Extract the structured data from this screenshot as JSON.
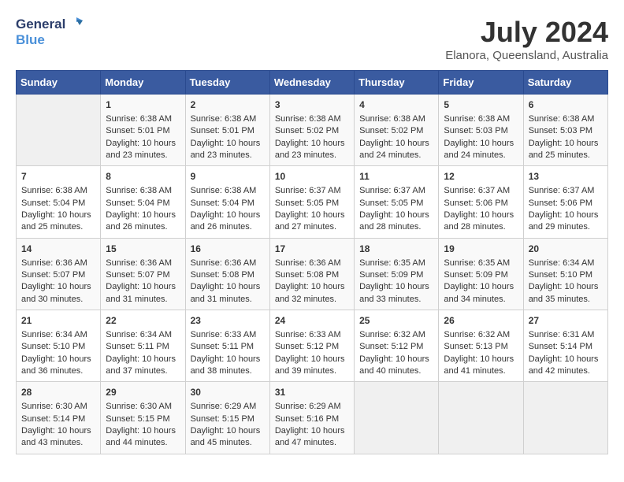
{
  "header": {
    "logo_line1": "General",
    "logo_line2": "Blue",
    "month_year": "July 2024",
    "location": "Elanora, Queensland, Australia"
  },
  "weekdays": [
    "Sunday",
    "Monday",
    "Tuesday",
    "Wednesday",
    "Thursday",
    "Friday",
    "Saturday"
  ],
  "weeks": [
    [
      {
        "day": "",
        "content": ""
      },
      {
        "day": "1",
        "content": "Sunrise: 6:38 AM\nSunset: 5:01 PM\nDaylight: 10 hours\nand 23 minutes."
      },
      {
        "day": "2",
        "content": "Sunrise: 6:38 AM\nSunset: 5:01 PM\nDaylight: 10 hours\nand 23 minutes."
      },
      {
        "day": "3",
        "content": "Sunrise: 6:38 AM\nSunset: 5:02 PM\nDaylight: 10 hours\nand 23 minutes."
      },
      {
        "day": "4",
        "content": "Sunrise: 6:38 AM\nSunset: 5:02 PM\nDaylight: 10 hours\nand 24 minutes."
      },
      {
        "day": "5",
        "content": "Sunrise: 6:38 AM\nSunset: 5:03 PM\nDaylight: 10 hours\nand 24 minutes."
      },
      {
        "day": "6",
        "content": "Sunrise: 6:38 AM\nSunset: 5:03 PM\nDaylight: 10 hours\nand 25 minutes."
      }
    ],
    [
      {
        "day": "7",
        "content": "Sunrise: 6:38 AM\nSunset: 5:04 PM\nDaylight: 10 hours\nand 25 minutes."
      },
      {
        "day": "8",
        "content": "Sunrise: 6:38 AM\nSunset: 5:04 PM\nDaylight: 10 hours\nand 26 minutes."
      },
      {
        "day": "9",
        "content": "Sunrise: 6:38 AM\nSunset: 5:04 PM\nDaylight: 10 hours\nand 26 minutes."
      },
      {
        "day": "10",
        "content": "Sunrise: 6:37 AM\nSunset: 5:05 PM\nDaylight: 10 hours\nand 27 minutes."
      },
      {
        "day": "11",
        "content": "Sunrise: 6:37 AM\nSunset: 5:05 PM\nDaylight: 10 hours\nand 28 minutes."
      },
      {
        "day": "12",
        "content": "Sunrise: 6:37 AM\nSunset: 5:06 PM\nDaylight: 10 hours\nand 28 minutes."
      },
      {
        "day": "13",
        "content": "Sunrise: 6:37 AM\nSunset: 5:06 PM\nDaylight: 10 hours\nand 29 minutes."
      }
    ],
    [
      {
        "day": "14",
        "content": "Sunrise: 6:36 AM\nSunset: 5:07 PM\nDaylight: 10 hours\nand 30 minutes."
      },
      {
        "day": "15",
        "content": "Sunrise: 6:36 AM\nSunset: 5:07 PM\nDaylight: 10 hours\nand 31 minutes."
      },
      {
        "day": "16",
        "content": "Sunrise: 6:36 AM\nSunset: 5:08 PM\nDaylight: 10 hours\nand 31 minutes."
      },
      {
        "day": "17",
        "content": "Sunrise: 6:36 AM\nSunset: 5:08 PM\nDaylight: 10 hours\nand 32 minutes."
      },
      {
        "day": "18",
        "content": "Sunrise: 6:35 AM\nSunset: 5:09 PM\nDaylight: 10 hours\nand 33 minutes."
      },
      {
        "day": "19",
        "content": "Sunrise: 6:35 AM\nSunset: 5:09 PM\nDaylight: 10 hours\nand 34 minutes."
      },
      {
        "day": "20",
        "content": "Sunrise: 6:34 AM\nSunset: 5:10 PM\nDaylight: 10 hours\nand 35 minutes."
      }
    ],
    [
      {
        "day": "21",
        "content": "Sunrise: 6:34 AM\nSunset: 5:10 PM\nDaylight: 10 hours\nand 36 minutes."
      },
      {
        "day": "22",
        "content": "Sunrise: 6:34 AM\nSunset: 5:11 PM\nDaylight: 10 hours\nand 37 minutes."
      },
      {
        "day": "23",
        "content": "Sunrise: 6:33 AM\nSunset: 5:11 PM\nDaylight: 10 hours\nand 38 minutes."
      },
      {
        "day": "24",
        "content": "Sunrise: 6:33 AM\nSunset: 5:12 PM\nDaylight: 10 hours\nand 39 minutes."
      },
      {
        "day": "25",
        "content": "Sunrise: 6:32 AM\nSunset: 5:12 PM\nDaylight: 10 hours\nand 40 minutes."
      },
      {
        "day": "26",
        "content": "Sunrise: 6:32 AM\nSunset: 5:13 PM\nDaylight: 10 hours\nand 41 minutes."
      },
      {
        "day": "27",
        "content": "Sunrise: 6:31 AM\nSunset: 5:14 PM\nDaylight: 10 hours\nand 42 minutes."
      }
    ],
    [
      {
        "day": "28",
        "content": "Sunrise: 6:30 AM\nSunset: 5:14 PM\nDaylight: 10 hours\nand 43 minutes."
      },
      {
        "day": "29",
        "content": "Sunrise: 6:30 AM\nSunset: 5:15 PM\nDaylight: 10 hours\nand 44 minutes."
      },
      {
        "day": "30",
        "content": "Sunrise: 6:29 AM\nSunset: 5:15 PM\nDaylight: 10 hours\nand 45 minutes."
      },
      {
        "day": "31",
        "content": "Sunrise: 6:29 AM\nSunset: 5:16 PM\nDaylight: 10 hours\nand 47 minutes."
      },
      {
        "day": "",
        "content": ""
      },
      {
        "day": "",
        "content": ""
      },
      {
        "day": "",
        "content": ""
      }
    ]
  ]
}
